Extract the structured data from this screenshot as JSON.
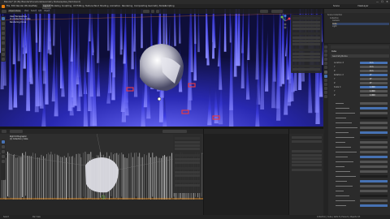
{
  "window": {
    "title": "Blender* [D:\\My Blender\\Procedural\\Geometry Nodes\\spikes_field.blend]",
    "controls": [
      "—",
      "☐",
      "✕"
    ]
  },
  "menubar": {
    "items": [
      "File",
      "Edit",
      "Render",
      "Window",
      "Help"
    ],
    "workspaces": [
      "Layout",
      "Modeling",
      "Sculpting",
      "UV Editing",
      "Texture Paint",
      "Shading",
      "Animation",
      "Rendering",
      "Compositing",
      "Geometry Nodes",
      "Scripting"
    ],
    "scene": "Scene",
    "view_layer": "ViewLayer"
  },
  "viewport_top": {
    "mode": "Object Mode",
    "menus": [
      "View",
      "Select",
      "Add",
      "Object"
    ],
    "overlay_lines": [
      "User Perspective",
      "(1) Collection | Cube",
      "Rendering Done"
    ],
    "colors": {
      "spike": "#3a3ad8",
      "spike_bright": "#6b6bff",
      "floor": "#2a2ab0",
      "sky": "#0e0e3a",
      "marker": "#e03a4a",
      "blob": "#d8d8d8"
    }
  },
  "viewport_bottom": {
    "overlay_lines": [
      "Right Orthographic",
      "(1) Collection | Cube"
    ],
    "colors": {
      "bars": "#e8e8e8",
      "ground": "#d88a2a"
    }
  },
  "outliner": {
    "items": [
      "Scene Collection",
      "Collection",
      "Camera",
      "Cube",
      "Light"
    ]
  },
  "properties": {
    "section": "Cube",
    "modifier": "GeometryNodes",
    "rows": [
      {
        "label": "Location X",
        "value": "0 m"
      },
      {
        "label": "Y",
        "value": "0 m"
      },
      {
        "label": "Z",
        "value": "0 m"
      },
      {
        "label": "Rotation X",
        "value": "0°"
      },
      {
        "label": "Y",
        "value": "0°"
      },
      {
        "label": "Z",
        "value": "0°"
      },
      {
        "label": "Scale X",
        "value": "1.000"
      },
      {
        "label": "Y",
        "value": "1.000"
      },
      {
        "label": "Z",
        "value": "1.000"
      }
    ]
  },
  "statusbar": {
    "left": "Select",
    "mid": "Pan View",
    "right": "Collection | Cube | Verts 8 | Faces 6 | Objects 1/3"
  }
}
